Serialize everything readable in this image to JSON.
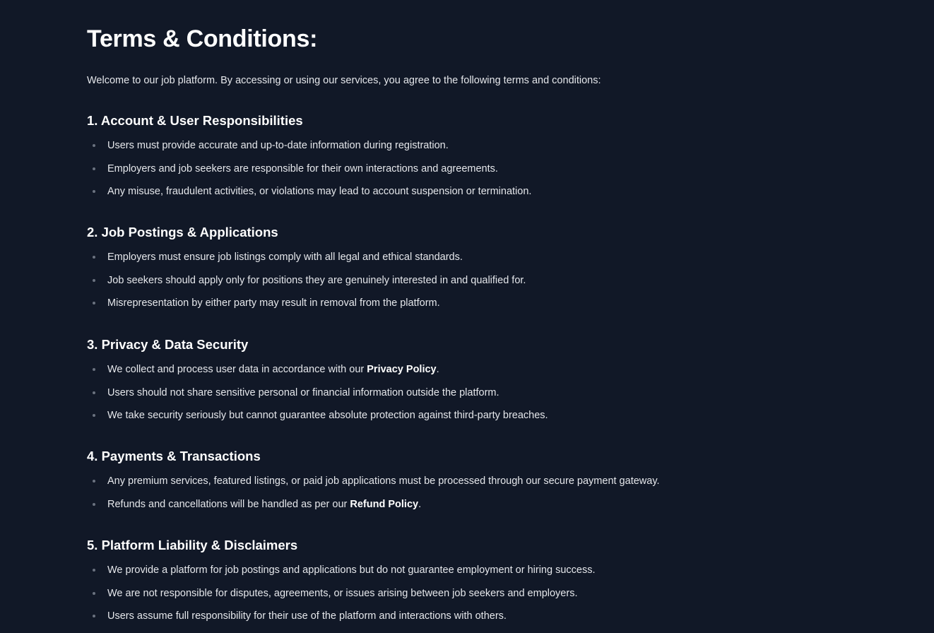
{
  "page": {
    "title": "Terms & Conditions:",
    "intro": "Welcome to our job platform. By accessing or using our services, you agree to the following terms and conditions:"
  },
  "sections": [
    {
      "heading": "1. Account & User Responsibilities",
      "items": [
        {
          "text": "Users must provide accurate and up-to-date information during registration."
        },
        {
          "text": "Employers and job seekers are responsible for their own interactions and agreements."
        },
        {
          "text": "Any misuse, fraudulent activities, or violations may lead to account suspension or termination."
        }
      ]
    },
    {
      "heading": "2. Job Postings & Applications",
      "items": [
        {
          "text": "Employers must ensure job listings comply with all legal and ethical standards."
        },
        {
          "text": "Job seekers should apply only for positions they are genuinely interested in and qualified for."
        },
        {
          "text": "Misrepresentation by either party may result in removal from the platform."
        }
      ]
    },
    {
      "heading": "3. Privacy & Data Security",
      "items": [
        {
          "text": "We collect and process user data in accordance with our ",
          "bold": "Privacy Policy",
          "after": "."
        },
        {
          "text": "Users should not share sensitive personal or financial information outside the platform."
        },
        {
          "text": "We take security seriously but cannot guarantee absolute protection against third-party breaches."
        }
      ]
    },
    {
      "heading": "4. Payments & Transactions",
      "items": [
        {
          "text": "Any premium services, featured listings, or paid job applications must be processed through our secure payment gateway."
        },
        {
          "text": "Refunds and cancellations will be handled as per our ",
          "bold": "Refund Policy",
          "after": "."
        }
      ]
    },
    {
      "heading": "5. Platform Liability & Disclaimers",
      "items": [
        {
          "text": "We provide a platform for job postings and applications but do not guarantee employment or hiring success."
        },
        {
          "text": "We are not responsible for disputes, agreements, or issues arising between job seekers and employers."
        },
        {
          "text": "Users assume full responsibility for their use of the platform and interactions with others."
        }
      ]
    }
  ]
}
